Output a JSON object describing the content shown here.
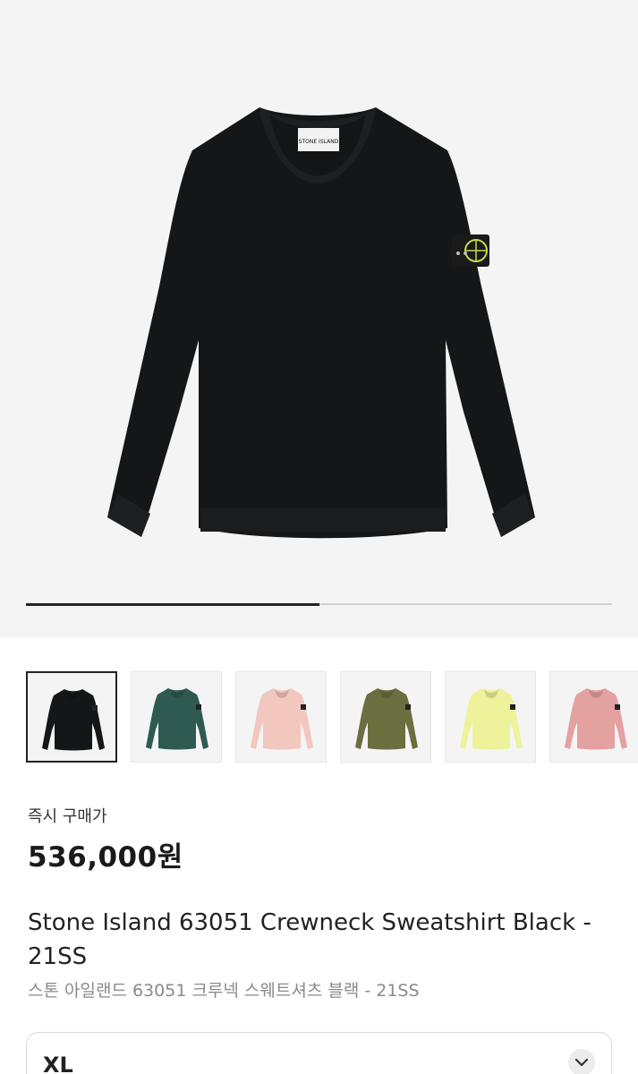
{
  "gallery": {
    "main_image": "black-crewneck-sweatshirt",
    "progress_fraction": 0.5,
    "thumbnails": [
      {
        "name": "thumb-black",
        "color": "#151617",
        "selected": true
      },
      {
        "name": "thumb-green",
        "color": "#2e5a52",
        "selected": false
      },
      {
        "name": "thumb-pink",
        "color": "#f2c7bd",
        "selected": false
      },
      {
        "name": "thumb-olive",
        "color": "#6b6e3f",
        "selected": false
      },
      {
        "name": "thumb-yellow",
        "color": "#eef29a",
        "selected": false
      },
      {
        "name": "thumb-rose",
        "color": "#e3a1a0",
        "selected": false
      }
    ]
  },
  "product": {
    "buy_now_label": "즉시 구매가",
    "price": "536,000원",
    "title_en": "Stone Island 63051 Crewneck Sweatshirt Black - 21SS",
    "title_ko": "스톤 아일랜드 63051 크루넥 스웨트셔츠 블랙 - 21SS",
    "brand_label_text": "STONE ISLAND"
  },
  "size_select": {
    "value": "XL",
    "icon": "chevron-down-icon"
  }
}
